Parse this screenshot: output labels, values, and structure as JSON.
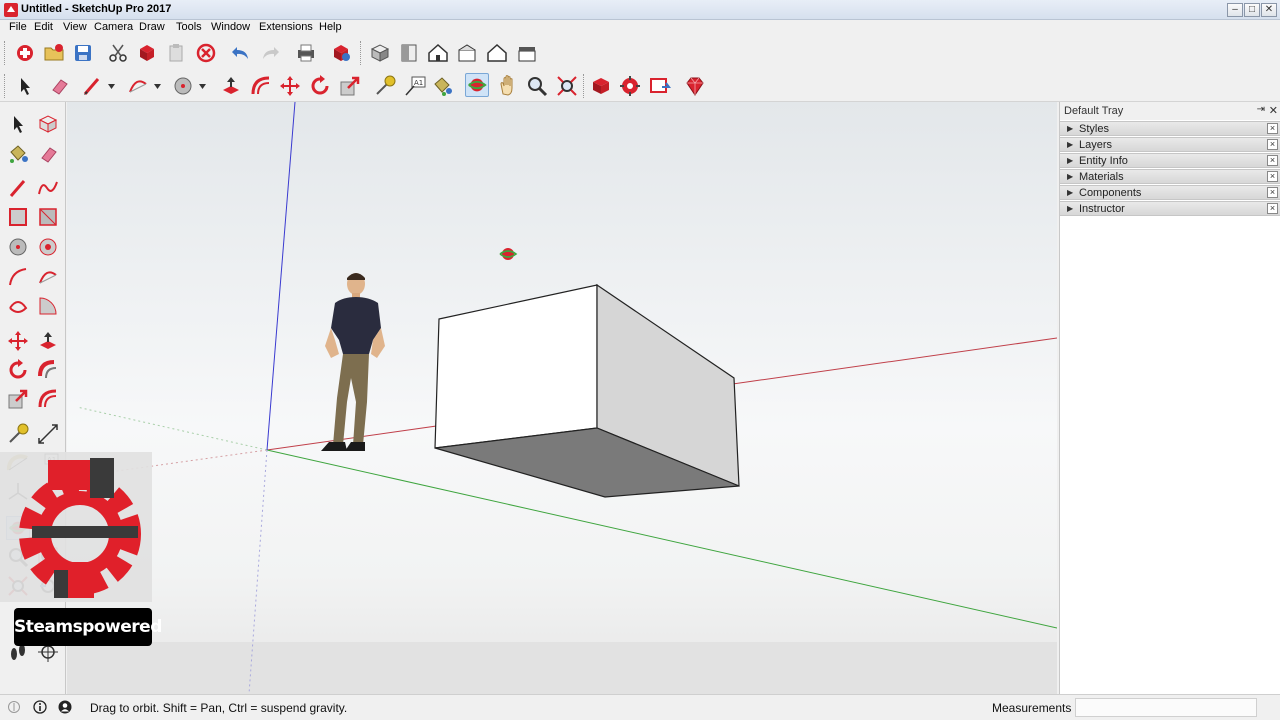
{
  "window": {
    "title": "Untitled - SketchUp Pro 2017",
    "controls": [
      "minimize",
      "maximize",
      "close"
    ]
  },
  "menu": [
    "File",
    "Edit",
    "View",
    "Camera",
    "Draw",
    "Tools",
    "Window",
    "Extensions",
    "Help"
  ],
  "toolbar_row1_icons": [
    "model-info-icon",
    "open-icon",
    "save-icon",
    "cut-icon",
    "copy-icon",
    "paste-icon",
    "erase-icon",
    "undo-icon",
    "redo-icon",
    "print-icon",
    "model-info-alt-icon",
    "iso-view-icon",
    "top-view-icon",
    "front-view-icon",
    "right-view-icon",
    "back-view-icon",
    "left-view-icon"
  ],
  "toolbar_row2_icons": [
    "select-icon",
    "eraser-icon",
    "line-icon",
    "arc-icon",
    "circle-icon",
    "push-pull-icon",
    "offset-icon",
    "move-icon",
    "rotate-icon",
    "scale-icon",
    "tape-measure-icon",
    "text-icon",
    "paint-bucket-icon",
    "orbit-icon",
    "pan-icon",
    "zoom-icon",
    "zoom-extents-icon",
    "3d-warehouse-icon",
    "extension-warehouse-icon",
    "layout-icon",
    "ruby-console-icon"
  ],
  "active_tool": "orbit",
  "tray": {
    "title": "Default Tray",
    "panels": [
      "Styles",
      "Layers",
      "Entity Info",
      "Materials",
      "Components",
      "Instructor"
    ]
  },
  "status": {
    "message": "Drag to orbit. Shift = Pan, Ctrl = suspend gravity.",
    "measurements_label": "Measurements",
    "measurements_value": ""
  },
  "watermark": {
    "text": "Steamspowered"
  },
  "colors": {
    "axis_red": "#c0404a",
    "axis_green": "#3fa53f",
    "axis_blue": "#3a3ad0",
    "accent_red": "#e0202a"
  }
}
